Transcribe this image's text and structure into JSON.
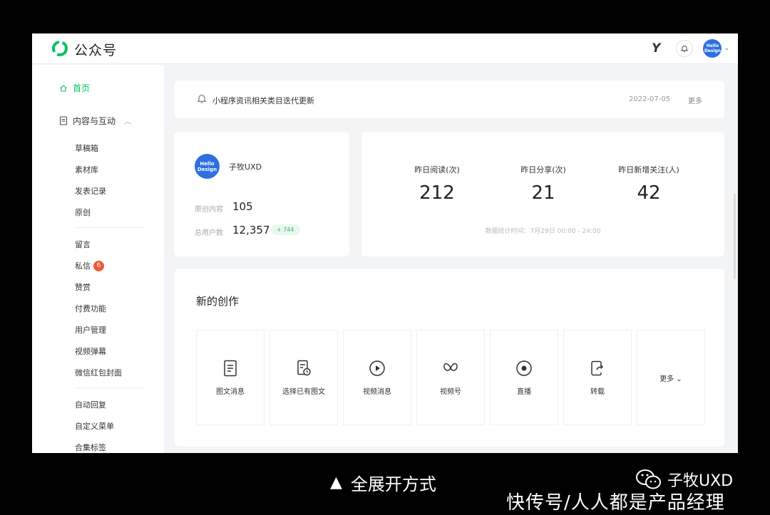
{
  "app": {
    "title": "公众号",
    "brand_color": "#07c160"
  },
  "topbar": {
    "y_logo": "Y",
    "avatar_line1": "Hello",
    "avatar_line2": "Design"
  },
  "sidebar": {
    "home": "首页",
    "group": "内容与互动",
    "items_a": [
      "草稿箱",
      "素材库",
      "发表记录",
      "原创"
    ],
    "items_b": [
      "留言",
      "私信",
      "赞赏",
      "付费功能",
      "用户管理",
      "视频弹幕",
      "微信红包封面"
    ],
    "items_c": [
      "自动回复",
      "自定义菜单",
      "合集标签"
    ],
    "private_msg_badge": "6"
  },
  "notice": {
    "text": "小程序资讯相关类目迭代更新",
    "date": "2022-07-05",
    "more": "更多"
  },
  "account": {
    "avatar_line1": "Hello",
    "avatar_line2": "Design",
    "name": "子牧UXD",
    "original_label": "原创内容",
    "original_value": "105",
    "users_label": "总用户数",
    "users_value": "12,357",
    "users_delta": "+ 744"
  },
  "stats": {
    "items": [
      {
        "label": "昨日阅读(次)",
        "value": "212"
      },
      {
        "label": "昨日分享(次)",
        "value": "21"
      },
      {
        "label": "昨日新增关注(人)",
        "value": "42"
      }
    ],
    "note": "数据统计时间：7月29日 00:00 - 24:00"
  },
  "creation": {
    "title": "新的创作",
    "tiles": [
      "图文消息",
      "选择已有图文",
      "视频消息",
      "视频号",
      "直播",
      "转载"
    ],
    "more": "更多"
  },
  "caption": {
    "text": "全展开方式"
  },
  "watermark": {
    "author": "子牧UXD",
    "site": "快传号/人人都是产品经理"
  }
}
